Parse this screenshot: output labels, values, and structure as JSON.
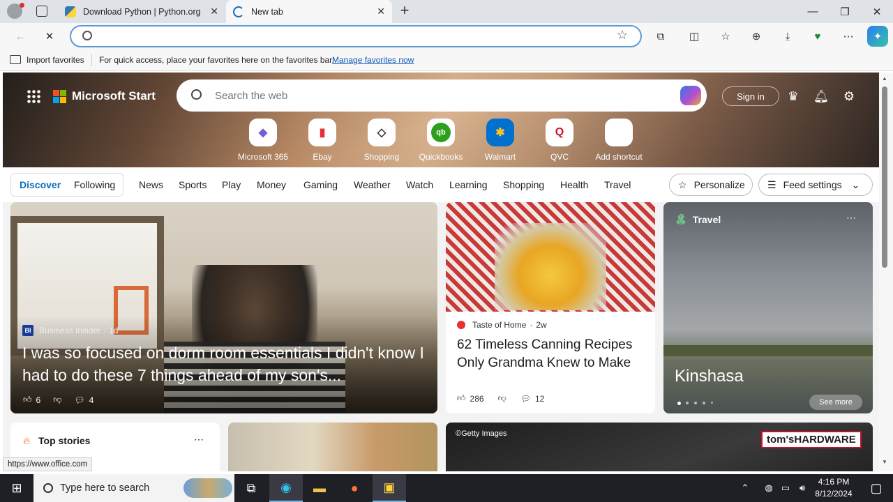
{
  "browser": {
    "tabs": [
      {
        "title": "Download Python | Python.org",
        "active": false
      },
      {
        "title": "New tab",
        "active": true
      }
    ],
    "address_value": "",
    "favorites_bar": {
      "import_label": "Import favorites",
      "hint": "For quick access, place your favorites here on the favorites bar.",
      "manage_link": "Manage favorites now"
    },
    "status_url": "https://www.office.com"
  },
  "page": {
    "brand": "Microsoft Start",
    "search_placeholder": "Search the web",
    "sign_in": "Sign in",
    "shortcuts": [
      {
        "label": "Microsoft 365",
        "icon": "microsoft-365-icon",
        "glyph": "◆",
        "color": "#7b5cd6"
      },
      {
        "label": "Ebay",
        "icon": "ebay-icon",
        "glyph": "▮",
        "color": "#e53238"
      },
      {
        "label": "Shopping",
        "icon": "shopping-tag-icon",
        "glyph": "◇",
        "color": "#333333"
      },
      {
        "label": "Quickbooks",
        "icon": "quickbooks-icon",
        "glyph": "qb",
        "color": "#2ca01c"
      },
      {
        "label": "Walmart",
        "icon": "walmart-icon",
        "glyph": "✱",
        "color": "#0071ce"
      },
      {
        "label": "QVC",
        "icon": "qvc-icon",
        "glyph": "Q",
        "color": "#c8102e"
      },
      {
        "label": "Add shortcut",
        "icon": "plus-icon",
        "glyph": "+",
        "color": "#333333"
      }
    ],
    "nav": {
      "primary": [
        "Discover",
        "Following"
      ],
      "items": [
        "News",
        "Sports",
        "Play",
        "Money",
        "Gaming",
        "Weather",
        "Watch",
        "Learning",
        "Shopping",
        "Health",
        "Travel"
      ],
      "personalize": "Personalize",
      "feed_settings": "Feed settings"
    },
    "cards": {
      "main": {
        "source": "Business Insider",
        "source_badge": "BI",
        "age": "1d",
        "title": "I was so focused on dorm room essentials I didn't know I had to do these 7 things ahead of my son's...",
        "likes": "6",
        "comments": "4"
      },
      "canning": {
        "source": "Taste of Home",
        "age": "2w",
        "title": "62 Timeless Canning Recipes Only Grandma Knew to Make",
        "likes": "286",
        "comments": "12"
      },
      "travel": {
        "category": "Travel",
        "title": "Kinshasa",
        "see_more": "See more"
      },
      "top_stories": {
        "title": "Top stories"
      },
      "getty": {
        "credit": "©Getty Images",
        "brand": "tom'sHARDWARE"
      }
    }
  },
  "taskbar": {
    "search_placeholder": "Type here to search",
    "time": "4:16 PM",
    "date": "8/12/2024"
  }
}
